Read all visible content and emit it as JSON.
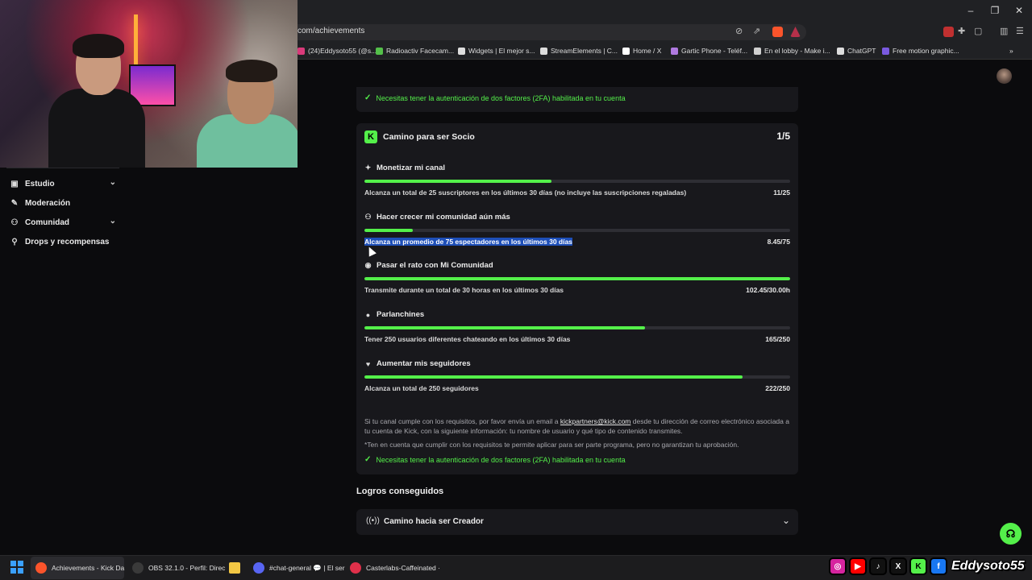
{
  "browser": {
    "url": "com/achievements",
    "bookmarks": [
      {
        "label": "(24)Eddysoto55 (@s...",
        "icon": "instagram-icon",
        "color": "#d93a7a"
      },
      {
        "label": "Radioactiv Facecam...",
        "icon": "radioactiv-icon",
        "color": "#54c04a"
      },
      {
        "label": "Widgets | El mejor s...",
        "icon": "widget-icon",
        "color": "#dddddd"
      },
      {
        "label": "StreamElements | C...",
        "icon": "streamelements-icon",
        "color": "#dddddd"
      },
      {
        "label": "Home / X",
        "icon": "x-icon",
        "color": "#ffffff"
      },
      {
        "label": "Gartic Phone - Teléf...",
        "icon": "gartic-icon",
        "color": "#b07ae0"
      },
      {
        "label": "En el lobby - Make i...",
        "icon": "lobby-icon",
        "color": "#d0d0d0"
      },
      {
        "label": "ChatGPT",
        "icon": "chatgpt-icon",
        "color": "#dddddd"
      },
      {
        "label": "Free motion graphic...",
        "icon": "motion-icon",
        "color": "#7a5ae0"
      }
    ],
    "more_bookmarks": "»"
  },
  "sidebar": {
    "items": [
      {
        "label": "Estudio",
        "icon": "studio-icon",
        "glyph": "▣",
        "expandable": true
      },
      {
        "label": "Moderación",
        "icon": "wrench-icon",
        "glyph": "✎",
        "expandable": false
      },
      {
        "label": "Comunidad",
        "icon": "community-icon",
        "glyph": "⚇",
        "expandable": true
      },
      {
        "label": "Drops y recompensas",
        "icon": "drops-icon",
        "glyph": "⚲",
        "expandable": false
      }
    ]
  },
  "top_card": {
    "notice": "Necesitas tener la autenticación de dos factores (2FA) habilitada en tu cuenta"
  },
  "partner_card": {
    "title": "Camino para ser Socio",
    "progress": "1/5",
    "requirements": [
      {
        "title": "Monetizar mi canal",
        "icon": "sparkle-icon",
        "glyph": "✦",
        "description": "Alcanza un total de 25 suscriptores en los últimos 30 días (no incluye las suscripciones regaladas)",
        "value": "11/25",
        "fraction": 0.44,
        "highlight": false
      },
      {
        "title": "Hacer crecer mi comunidad aún más",
        "icon": "users-icon",
        "glyph": "⚇",
        "description": "Alcanza un promedio de 75 espectadores en los últimos 30 días",
        "value": "8.45/75",
        "fraction": 0.113,
        "highlight": true
      },
      {
        "title": "Pasar el rato con Mi Comunidad",
        "icon": "broadcast-icon",
        "glyph": "◉",
        "description": "Transmite durante un total de 30 horas en los últimos 30 días",
        "value": "102.45/30.00h",
        "fraction": 1.0,
        "highlight": false
      },
      {
        "title": "Parlanchines",
        "icon": "chat-bubble-icon",
        "glyph": "●",
        "description": "Tener 250 usuarios diferentes chateando en los últimos 30 días",
        "value": "165/250",
        "fraction": 0.66,
        "highlight": false
      },
      {
        "title": "Aumentar mis seguidores",
        "icon": "heart-icon",
        "glyph": "♥",
        "description": "Alcanza un total de 250 seguidores",
        "value": "222/250",
        "fraction": 0.888,
        "highlight": false
      }
    ],
    "info_before_link": "Si tu canal cumple con los requisitos, por favor envía un email a",
    "info_link": "kickpartners@kick.com",
    "info_after_link": "desde tu dirección de correo electrónico asociada a tu cuenta de Kick, con la siguiente información: tu nombre de usuario y qué tipo de contenido transmites.",
    "disclaimer": "*Ten en cuenta que cumplir con los requisitos te permite aplicar para ser parte programa, pero no garantizan tu aprobación.",
    "notice": "Necesitas tener la autenticación de dos factores (2FA) habilitada en tu cuenta"
  },
  "achievements": {
    "heading": "Logros conseguidos",
    "accordion_title": "Camino hacia ser Creador"
  },
  "taskbar": {
    "items": [
      {
        "label": "Achievements - Kick Da",
        "icon": "brave-icon",
        "color": "#fb542b"
      },
      {
        "label": "OBS 32.1.0 - Perfil: Direc",
        "icon": "obs-icon",
        "color": "#3a3a3a"
      },
      {
        "label": "",
        "icon": "folder-icon",
        "color": "#f2c744"
      },
      {
        "label": "#chat-general 💬 | El ser",
        "icon": "discord-icon",
        "color": "#5865f2"
      },
      {
        "label": "Casterlabs-Caffeinated ·",
        "icon": "casterlabs-icon",
        "color": "#e0304a"
      }
    ]
  },
  "overlay": {
    "handle": "Eddysoto55",
    "socials": [
      {
        "icon": "instagram-icon",
        "glyph": "◎",
        "color": "#d6249f"
      },
      {
        "icon": "youtube-icon",
        "glyph": "▶",
        "color": "#ff0000"
      },
      {
        "icon": "tiktok-icon",
        "glyph": "♪",
        "color": "#111111"
      },
      {
        "icon": "x-icon",
        "glyph": "X",
        "color": "#111111"
      },
      {
        "icon": "kick-icon",
        "glyph": "K",
        "color": "#54f04a"
      },
      {
        "icon": "facebook-icon",
        "glyph": "f",
        "color": "#1877f2"
      }
    ]
  },
  "colors": {
    "accent": "#54f04a",
    "card_bg": "#18181c",
    "page_bg": "#0b0b0d",
    "highlight": "#1e4fb8"
  }
}
